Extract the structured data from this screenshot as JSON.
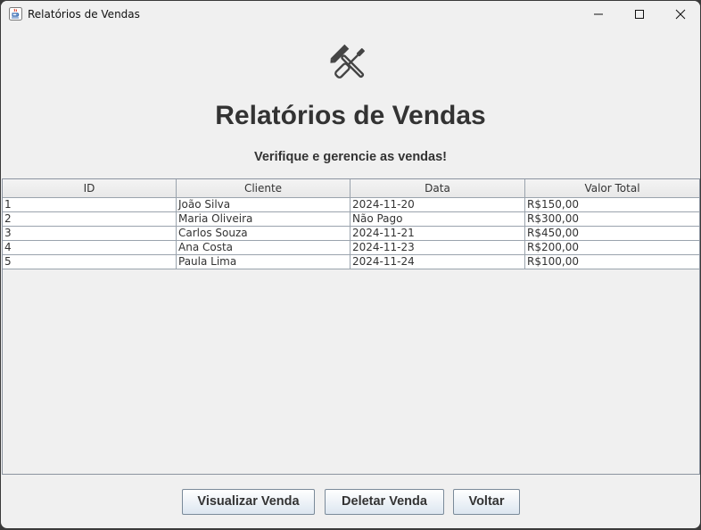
{
  "window": {
    "title": "Relatórios de Vendas"
  },
  "header": {
    "icon": "tools-icon",
    "title": "Relatórios de Vendas",
    "subtitle": "Verifique e gerencie as vendas!"
  },
  "table": {
    "columns": [
      "ID",
      "Cliente",
      "Data",
      "Valor Total"
    ],
    "rows": [
      [
        "1",
        "João Silva",
        "2024-11-20",
        "R$150,00"
      ],
      [
        "2",
        "Maria Oliveira",
        "Não Pago",
        "R$300,00"
      ],
      [
        "3",
        "Carlos Souza",
        "2024-11-21",
        "R$450,00"
      ],
      [
        "4",
        "Ana Costa",
        "2024-11-23",
        "R$200,00"
      ],
      [
        "5",
        "Paula Lima",
        "2024-11-24",
        "R$100,00"
      ]
    ]
  },
  "actions": {
    "view": "Visualizar Venda",
    "delete": "Deletar Venda",
    "back": "Voltar"
  }
}
